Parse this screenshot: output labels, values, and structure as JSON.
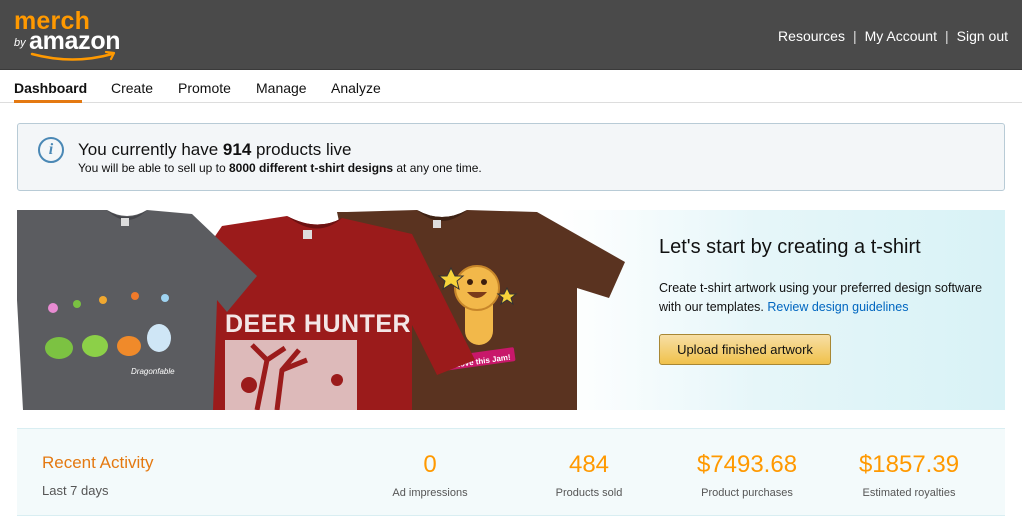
{
  "header": {
    "logo_top": "merch",
    "logo_by": "by",
    "logo_brand": "amazon",
    "links": [
      "Resources",
      "My Account",
      "Sign out"
    ],
    "separator": "|",
    "brand_color": "#ff9900"
  },
  "nav": {
    "tabs": [
      "Dashboard",
      "Create",
      "Promote",
      "Manage",
      "Analyze"
    ],
    "active": "Dashboard"
  },
  "info": {
    "icon": "info-icon",
    "line1_pre": "You currently have ",
    "line1_count": "914",
    "line1_post": " products live",
    "line2_pre": "You will be able to sell up to ",
    "line2_bold": "8000 different t-shirt designs",
    "line2_post": " at any one time."
  },
  "hero": {
    "title": "Let's start by creating a t-shirt",
    "desc_pre": "Create t-shirt artwork using your preferred design software with our templates. ",
    "desc_link": "Review design guidelines",
    "button": "Upload finished artwork",
    "shirt1_text": "Dragonfable",
    "shirt2_text": "DEER HUNTER",
    "shirt3_text": "I Love this Jam!"
  },
  "activity": {
    "title": "Recent Activity",
    "subtitle": "Last 7 days",
    "metrics": [
      {
        "value": "0",
        "label": "Ad impressions"
      },
      {
        "value": "484",
        "label": "Products sold"
      },
      {
        "value": "$7493.68",
        "label": "Product purchases"
      },
      {
        "value": "$1857.39",
        "label": "Estimated royalties"
      }
    ]
  }
}
